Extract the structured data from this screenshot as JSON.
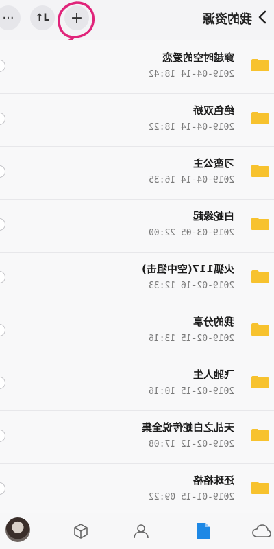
{
  "header": {
    "title": "我的资源",
    "more_label": "···",
    "sort_label": "↑L",
    "add_label": "+"
  },
  "files": [
    {
      "name": "穿越时空的爱恋",
      "date": "2019-04-14 18:42"
    },
    {
      "name": "绝色双娇",
      "date": "2019-04-14 18:22"
    },
    {
      "name": "刁蛮公主",
      "date": "2019-04-14 16:35"
    },
    {
      "name": "白蛇缘起",
      "date": "2019-03-05 22:00"
    },
    {
      "name": "火狐117(空中狙击)",
      "date": "2019-02-16 12:33"
    },
    {
      "name": "我的分享",
      "date": "2019-02-15 13:16"
    },
    {
      "name": "飞驰人生",
      "date": "2019-02-15 10:16"
    },
    {
      "name": "天乩之白蛇传说全集",
      "date": "2019-02-12 17:08"
    },
    {
      "name": "还珠格格",
      "date": "2019-01-15 09:22"
    }
  ],
  "colors": {
    "folder": "#f7c22e",
    "nav_active": "#1e88e5",
    "annotation": "#e0247a"
  },
  "icons": {
    "more": "more-icon",
    "sort": "sort-icon",
    "add": "plus-icon",
    "back": "chevron-left-icon",
    "folder": "folder-icon",
    "nav": [
      "avatar",
      "cube-icon",
      "people-icon",
      "file-icon",
      "cloud-icon"
    ]
  }
}
